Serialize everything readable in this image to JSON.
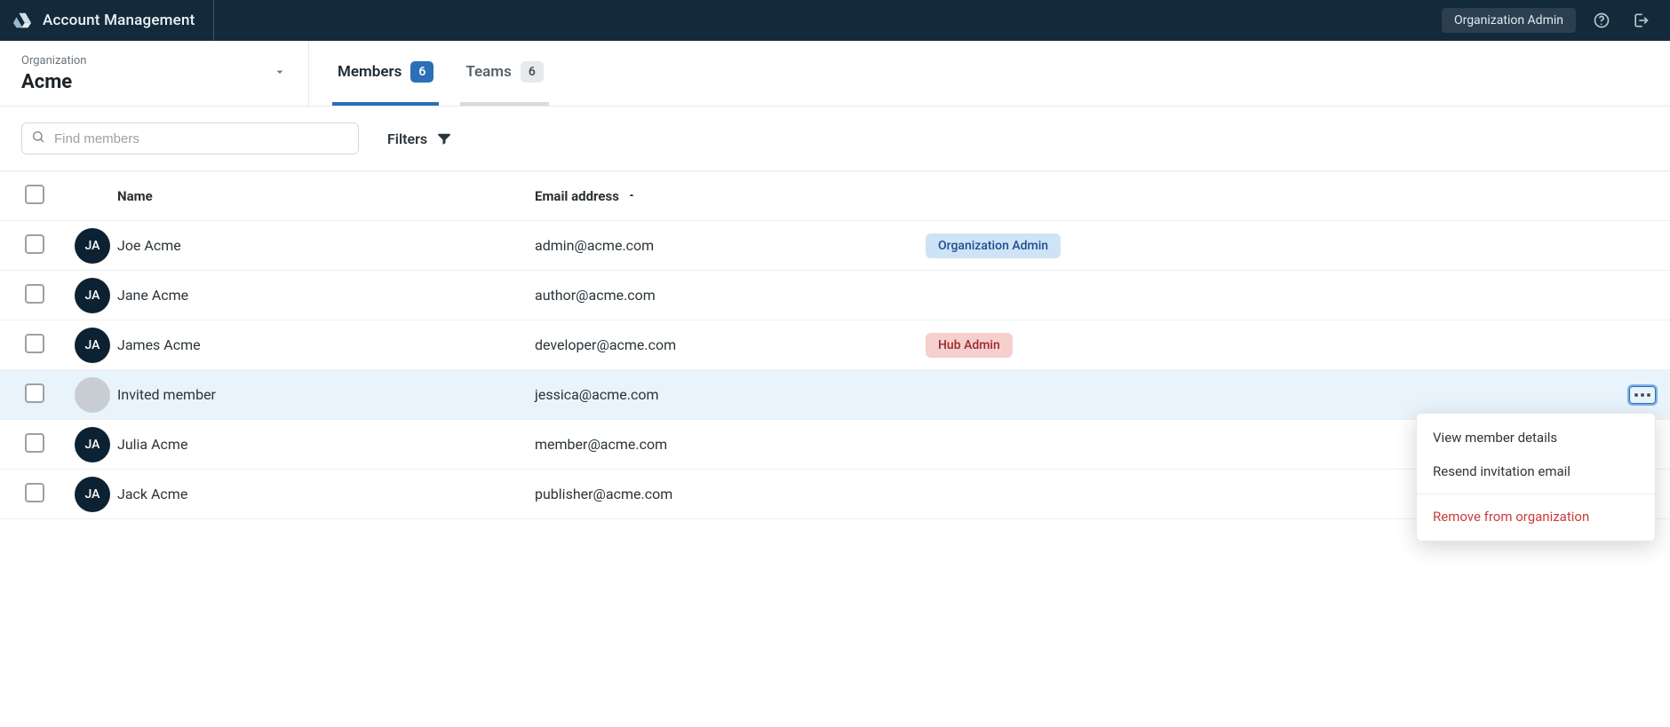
{
  "topbar": {
    "app_title": "Account Management",
    "role_chip": "Organization Admin",
    "icons": {
      "brand": "drive-icon",
      "help": "help-icon",
      "logout": "logout-icon"
    }
  },
  "org_selector": {
    "label": "Organization",
    "name": "Acme"
  },
  "tabs": {
    "items": [
      {
        "label": "Members",
        "count": "6",
        "active": true
      },
      {
        "label": "Teams",
        "count": "6",
        "active": false
      }
    ]
  },
  "toolbar": {
    "search_placeholder": "Find members",
    "filters_label": "Filters"
  },
  "table": {
    "headers": {
      "name": "Name",
      "email": "Email address",
      "sort_dir": "asc"
    },
    "rows": [
      {
        "initials": "JA",
        "invited": false,
        "name": "Joe Acme",
        "email": "admin@acme.com",
        "role": "Organization Admin",
        "role_style": "blue"
      },
      {
        "initials": "JA",
        "invited": false,
        "name": "Jane Acme",
        "email": "author@acme.com",
        "role": "",
        "role_style": ""
      },
      {
        "initials": "JA",
        "invited": false,
        "name": "James Acme",
        "email": "developer@acme.com",
        "role": "Hub Admin",
        "role_style": "red"
      },
      {
        "initials": "",
        "invited": true,
        "name": "Invited member",
        "email": "jessica@acme.com",
        "role": "",
        "role_style": "",
        "selected": true
      },
      {
        "initials": "JA",
        "invited": false,
        "name": "Julia Acme",
        "email": "member@acme.com",
        "role": "",
        "role_style": ""
      },
      {
        "initials": "JA",
        "invited": false,
        "name": "Jack Acme",
        "email": "publisher@acme.com",
        "role": "",
        "role_style": ""
      }
    ]
  },
  "context_menu": {
    "open_for_row_index": 3,
    "items": [
      {
        "label": "View member details",
        "kind": "item"
      },
      {
        "label": "Resend invitation email",
        "kind": "item"
      },
      {
        "label": "",
        "kind": "divider"
      },
      {
        "label": "Remove from organization",
        "kind": "danger"
      }
    ]
  }
}
